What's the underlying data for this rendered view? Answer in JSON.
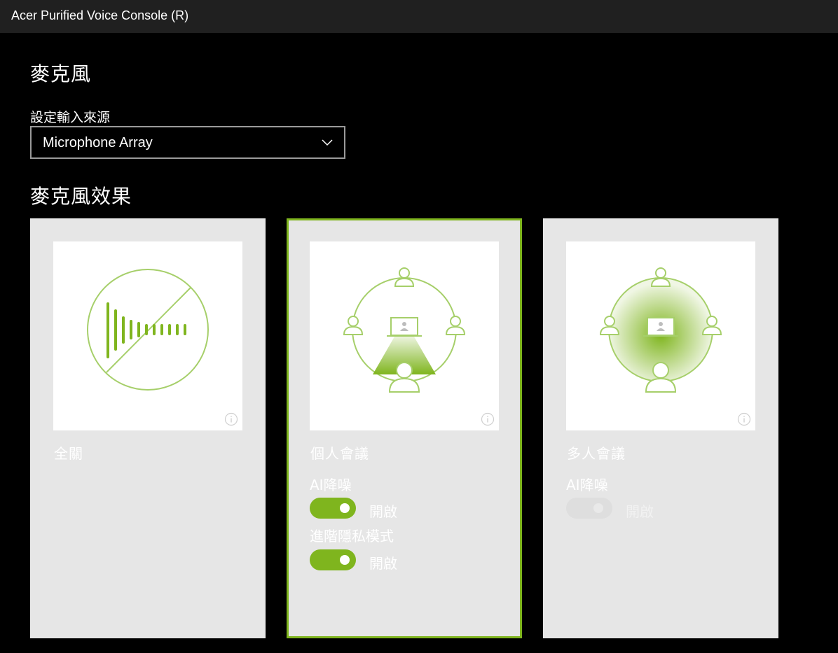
{
  "window": {
    "title": "Acer Purified Voice Console (R)"
  },
  "microphone": {
    "heading": "麥克風",
    "input_label": "設定輸入來源",
    "input_value": "Microphone Array"
  },
  "effects": {
    "heading": "麥克風效果",
    "cards": [
      {
        "title": "全關",
        "icon": "no-audio-waveform-icon",
        "selected": false
      },
      {
        "title": "個人會議",
        "icon": "single-speaker-beam-icon",
        "selected": true,
        "options": [
          {
            "label": "AI降噪",
            "state": "開啟",
            "on": true,
            "enabled": true
          },
          {
            "label": "進階隱私模式",
            "state": "開啟",
            "on": true,
            "enabled": true
          }
        ]
      },
      {
        "title": "多人會議",
        "icon": "multi-speaker-omni-icon",
        "selected": false,
        "options": [
          {
            "label": "AI降噪",
            "state": "開啟",
            "on": true,
            "enabled": false
          }
        ]
      }
    ]
  },
  "colors": {
    "accent": "#7fb51e",
    "card_bg": "#e6e6e6",
    "titlebar": "#202020"
  }
}
